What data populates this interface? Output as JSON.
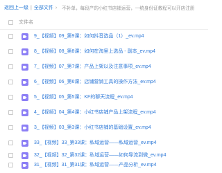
{
  "breadcrumb": {
    "back_label": "返回上一级",
    "separator": "|",
    "all_files_label": "全部文件",
    "arrow": "›"
  },
  "notice": "不补单，每段产的小红书店铺运营，一统身份证教程可以开店注册",
  "header": {
    "column_label": "文件名"
  },
  "files": [
    {
      "name": "9_【视频】09_第9课：如何抖音选品（1）_ev.mp4"
    },
    {
      "name": "8_【视频】08_第8课：如何在淘里上选品 - 副本_ev.mp4"
    },
    {
      "name": "7_【视频】07_第7课：产品上架以及注意事项_ev.mp4"
    },
    {
      "name": "6_【视频】06_第6课：店铺营销工具的操作方法_ev.mp4"
    },
    {
      "name": "5_【视频】05_第5课：KF的聊天流程_ev.mp4"
    },
    {
      "name": "4_【视频】04_第4课：小红书店铺产品上架流程_ev.mp4"
    },
    {
      "name": "3_【视频】03_第3课：小红书店铺的基础设置_ev.mp4"
    },
    {
      "name": "33_【视频】33_第33课：私域运营——私域运营_ev.mp4"
    },
    {
      "name": "32_【视频】32_第32课：私域运营——如何导流到微_ev.mp4"
    },
    {
      "name": "31_【视频】31_第31课：私域运营——产品分析_ev.mp4"
    }
  ],
  "colors": {
    "link": "#2f7ad8",
    "video_icon": "#8c7ff5"
  }
}
